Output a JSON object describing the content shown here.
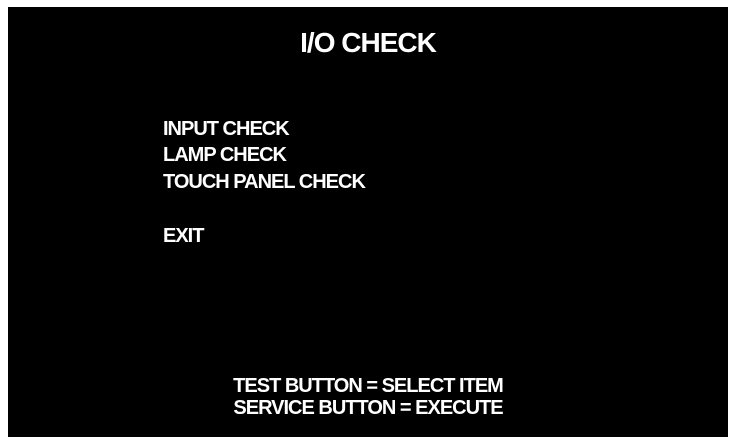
{
  "screen": {
    "title": "I/O CHECK",
    "menu": [
      {
        "label": "INPUT CHECK"
      },
      {
        "label": "LAMP CHECK"
      },
      {
        "label": "TOUCH PANEL CHECK"
      },
      {
        "label": "EXIT"
      }
    ],
    "instructions": {
      "line1": "TEST BUTTON = SELECT ITEM",
      "line2": "SERVICE BUTTON = EXECUTE"
    },
    "colors": {
      "background": "#000000",
      "text": "#ffffff"
    }
  }
}
